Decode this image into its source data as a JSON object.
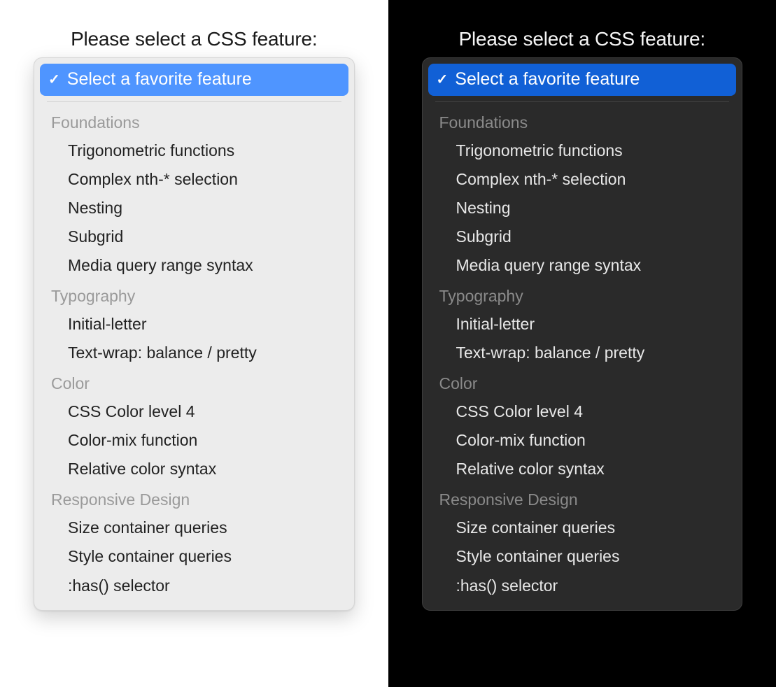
{
  "prompt": "Please select a CSS feature:",
  "selected_option": "Select a favorite feature",
  "colors": {
    "light_accent": "#4f95ff",
    "dark_accent": "#1160d6"
  },
  "groups": [
    {
      "label": "Foundations",
      "options": [
        "Trigonometric functions",
        "Complex nth-* selection",
        "Nesting",
        "Subgrid",
        "Media query range syntax"
      ]
    },
    {
      "label": "Typography",
      "options": [
        "Initial-letter",
        "Text-wrap: balance / pretty"
      ]
    },
    {
      "label": "Color",
      "options": [
        "CSS Color level 4",
        "Color-mix function",
        "Relative color syntax"
      ]
    },
    {
      "label": "Responsive Design",
      "options": [
        "Size container queries",
        "Style container queries",
        ":has() selector"
      ]
    }
  ]
}
